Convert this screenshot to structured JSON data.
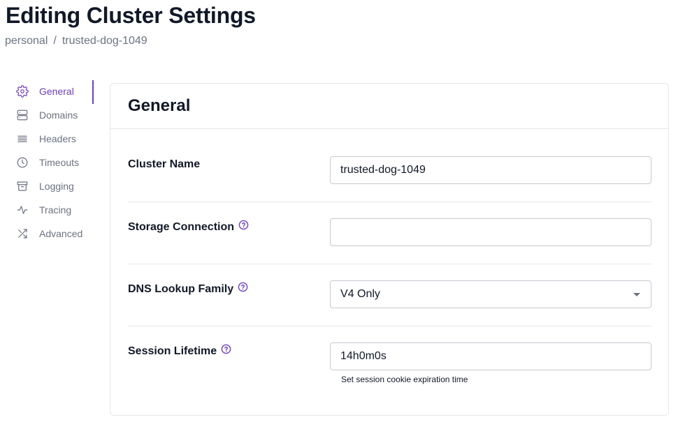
{
  "page": {
    "title": "Editing Cluster Settings",
    "breadcrumb": [
      "personal",
      "trusted-dog-1049"
    ],
    "breadcrumb_separator": "/"
  },
  "sidebar": {
    "active_color": "#6d3fc0",
    "items": [
      {
        "label": "General",
        "icon": "gear-icon",
        "active": true
      },
      {
        "label": "Domains",
        "icon": "server-icon",
        "active": false
      },
      {
        "label": "Headers",
        "icon": "list-icon",
        "active": false
      },
      {
        "label": "Timeouts",
        "icon": "clock-icon",
        "active": false
      },
      {
        "label": "Logging",
        "icon": "archive-icon",
        "active": false
      },
      {
        "label": "Tracing",
        "icon": "activity-icon",
        "active": false
      },
      {
        "label": "Advanced",
        "icon": "shuffle-icon",
        "active": false
      }
    ]
  },
  "panel": {
    "title": "General",
    "fields": {
      "cluster_name": {
        "label": "Cluster Name",
        "value": "trusted-dog-1049"
      },
      "storage_connection": {
        "label": "Storage Connection",
        "value": "",
        "has_help": true
      },
      "dns_lookup_family": {
        "label": "DNS Lookup Family",
        "value": "V4 Only",
        "has_help": true
      },
      "session_lifetime": {
        "label": "Session Lifetime",
        "value": "14h0m0s",
        "has_help": true,
        "helper": "Set session cookie expiration time"
      }
    }
  }
}
